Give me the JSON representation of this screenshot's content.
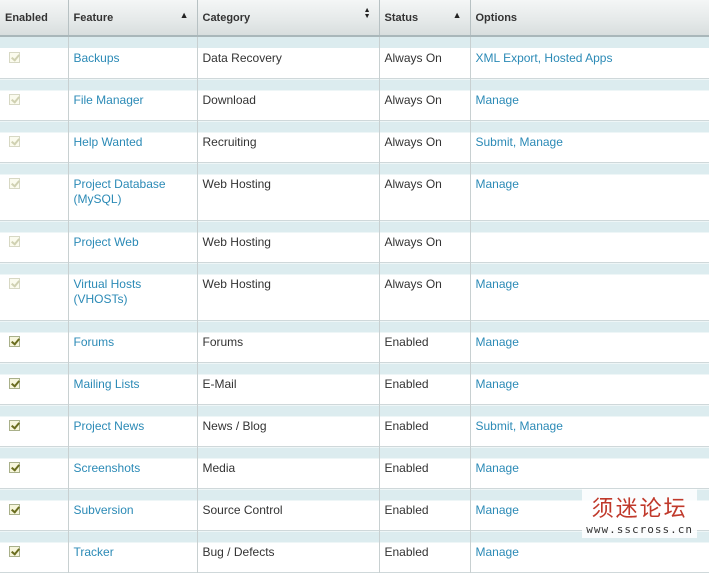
{
  "columns": {
    "enabled": "Enabled",
    "feature": "Feature",
    "category": "Category",
    "status": "Status",
    "options": "Options"
  },
  "rows": [
    {
      "checked": true,
      "locked": true,
      "feature": "Backups",
      "category": "Data Recovery",
      "status": "Always On",
      "options": [
        "XML Export",
        "Hosted Apps"
      ]
    },
    {
      "checked": true,
      "locked": true,
      "feature": "File Manager",
      "category": "Download",
      "status": "Always On",
      "options": [
        "Manage"
      ]
    },
    {
      "checked": true,
      "locked": true,
      "feature": "Help Wanted",
      "category": "Recruiting",
      "status": "Always On",
      "options": [
        "Submit",
        "Manage"
      ]
    },
    {
      "checked": true,
      "locked": true,
      "feature": "Project Database (MySQL)",
      "category": "Web Hosting",
      "status": "Always On",
      "options": [
        "Manage"
      ]
    },
    {
      "checked": true,
      "locked": true,
      "feature": "Project Web",
      "category": "Web Hosting",
      "status": "Always On",
      "options": []
    },
    {
      "checked": true,
      "locked": true,
      "feature": "Virtual Hosts (VHOSTs)",
      "category": "Web Hosting",
      "status": "Always On",
      "options": [
        "Manage"
      ]
    },
    {
      "checked": true,
      "locked": false,
      "feature": "Forums",
      "category": "Forums",
      "status": "Enabled",
      "options": [
        "Manage"
      ]
    },
    {
      "checked": true,
      "locked": false,
      "feature": "Mailing Lists",
      "category": "E-Mail",
      "status": "Enabled",
      "options": [
        "Manage"
      ]
    },
    {
      "checked": true,
      "locked": false,
      "feature": "Project News",
      "category": "News / Blog",
      "status": "Enabled",
      "options": [
        "Submit",
        "Manage"
      ]
    },
    {
      "checked": true,
      "locked": false,
      "feature": "Screenshots",
      "category": "Media",
      "status": "Enabled",
      "options": [
        "Manage"
      ]
    },
    {
      "checked": true,
      "locked": false,
      "feature": "Subversion",
      "category": "Source Control",
      "status": "Enabled",
      "options": [
        "Manage"
      ]
    },
    {
      "checked": true,
      "locked": false,
      "feature": "Tracker",
      "category": "Bug / Defects",
      "status": "Enabled",
      "options": [
        "Manage"
      ]
    }
  ],
  "watermark": {
    "cn": "须迷论坛",
    "en": "www.sscross.cn"
  },
  "colors": {
    "link": "#2b8ab6",
    "row_band": "#dcecef",
    "header": "#e6eaea",
    "watermark_red": "#c0392b"
  }
}
